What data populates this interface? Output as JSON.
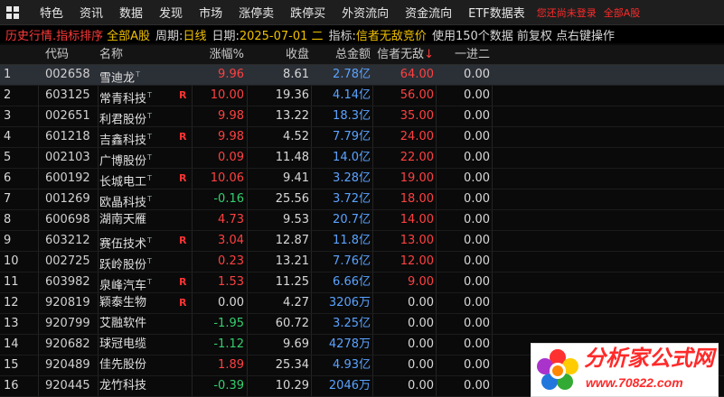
{
  "menubar": {
    "items": [
      "特色",
      "资讯",
      "数据",
      "发现",
      "市场",
      "涨停卖",
      "跌停买",
      "外资流向",
      "资金流向",
      "ETF数据表"
    ],
    "alert": "您还尚未登录",
    "alert2": "全部A股"
  },
  "infobar": {
    "title": "历史行情.指标排序",
    "scope": "全部A股",
    "period_label": "周期:",
    "period": "日线",
    "date_label": "日期:",
    "date": "2025-07-01 二",
    "indicator_label": "指标:",
    "indicator": "信者无敌竞价",
    "note": "使用150个数据 前复权 点右键操作"
  },
  "table": {
    "columns": {
      "code": "代码",
      "name": "名称",
      "pct": "涨幅%",
      "close": "收盘",
      "amount": "总金额",
      "xzwd": "信者无敌",
      "sort_arrow": "↓",
      "yjer": "一进二"
    },
    "rows": [
      {
        "idx": "1",
        "code": "002658",
        "name": "雪迪龙",
        "sup": "T",
        "r": "",
        "pct": "9.96",
        "close": "8.61",
        "amount": "2.78亿",
        "xzwd": "64.00",
        "yjer": "0.00",
        "dir": "pos"
      },
      {
        "idx": "2",
        "code": "603125",
        "name": "常青科技",
        "sup": "T",
        "r": "R",
        "pct": "10.00",
        "close": "19.36",
        "amount": "4.14亿",
        "xzwd": "56.00",
        "yjer": "0.00",
        "dir": "pos"
      },
      {
        "idx": "3",
        "code": "002651",
        "name": "利君股份",
        "sup": "T",
        "r": "",
        "pct": "9.98",
        "close": "13.22",
        "amount": "18.3亿",
        "xzwd": "35.00",
        "yjer": "0.00",
        "dir": "pos"
      },
      {
        "idx": "4",
        "code": "601218",
        "name": "吉鑫科技",
        "sup": "T",
        "r": "R",
        "pct": "9.98",
        "close": "4.52",
        "amount": "7.79亿",
        "xzwd": "24.00",
        "yjer": "0.00",
        "dir": "pos"
      },
      {
        "idx": "5",
        "code": "002103",
        "name": "广博股份",
        "sup": "T",
        "r": "",
        "pct": "0.09",
        "close": "11.48",
        "amount": "14.0亿",
        "xzwd": "22.00",
        "yjer": "0.00",
        "dir": "pos"
      },
      {
        "idx": "6",
        "code": "600192",
        "name": "长城电工",
        "sup": "T",
        "r": "R",
        "pct": "10.06",
        "close": "9.41",
        "amount": "3.28亿",
        "xzwd": "19.00",
        "yjer": "0.00",
        "dir": "pos"
      },
      {
        "idx": "7",
        "code": "001269",
        "name": "欧晶科技",
        "sup": "T",
        "r": "",
        "pct": "-0.16",
        "close": "25.56",
        "amount": "3.72亿",
        "xzwd": "18.00",
        "yjer": "0.00",
        "dir": "neg"
      },
      {
        "idx": "8",
        "code": "600698",
        "name": "湖南天雁",
        "sup": "",
        "r": "",
        "pct": "4.73",
        "close": "9.53",
        "amount": "20.7亿",
        "xzwd": "14.00",
        "yjer": "0.00",
        "dir": "pos"
      },
      {
        "idx": "9",
        "code": "603212",
        "name": "赛伍技术",
        "sup": "T",
        "r": "R",
        "pct": "3.04",
        "close": "12.87",
        "amount": "11.8亿",
        "xzwd": "13.00",
        "yjer": "0.00",
        "dir": "pos"
      },
      {
        "idx": "10",
        "code": "002725",
        "name": "跃岭股份",
        "sup": "T",
        "r": "",
        "pct": "0.23",
        "close": "13.21",
        "amount": "7.76亿",
        "xzwd": "12.00",
        "yjer": "0.00",
        "dir": "pos"
      },
      {
        "idx": "11",
        "code": "603982",
        "name": "泉峰汽车",
        "sup": "T",
        "r": "R",
        "pct": "1.53",
        "close": "11.25",
        "amount": "6.66亿",
        "xzwd": "9.00",
        "yjer": "0.00",
        "dir": "pos"
      },
      {
        "idx": "12",
        "code": "920819",
        "name": "颖泰生物",
        "sup": "",
        "r": "R",
        "pct": "0.00",
        "close": "4.27",
        "amount": "3206万",
        "xzwd": "0.00",
        "yjer": "0.00",
        "dir": "flat"
      },
      {
        "idx": "13",
        "code": "920799",
        "name": "艾融软件",
        "sup": "",
        "r": "",
        "pct": "-1.95",
        "close": "60.72",
        "amount": "3.25亿",
        "xzwd": "0.00",
        "yjer": "0.00",
        "dir": "neg"
      },
      {
        "idx": "14",
        "code": "920682",
        "name": "球冠电缆",
        "sup": "",
        "r": "",
        "pct": "-1.12",
        "close": "9.69",
        "amount": "4278万",
        "xzwd": "0.00",
        "yjer": "0.00",
        "dir": "neg"
      },
      {
        "idx": "15",
        "code": "920489",
        "name": "佳先股份",
        "sup": "",
        "r": "",
        "pct": "1.89",
        "close": "25.34",
        "amount": "4.93亿",
        "xzwd": "0.00",
        "yjer": "0.00",
        "dir": "pos"
      },
      {
        "idx": "16",
        "code": "920445",
        "name": "龙竹科技",
        "sup": "",
        "r": "",
        "pct": "-0.39",
        "close": "10.29",
        "amount": "2046万",
        "xzwd": "0.00",
        "yjer": "0.00",
        "dir": "neg"
      }
    ]
  },
  "watermark": {
    "title": "分析家公式网",
    "url": "www.70822.com"
  },
  "colors": {
    "up": "#ff4040",
    "down": "#34d06e",
    "amount": "#5aa3ff",
    "accent_yellow": "#f0c000"
  }
}
